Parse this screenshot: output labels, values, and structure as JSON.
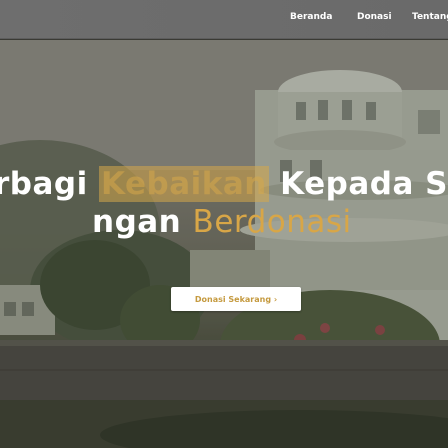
{
  "nav": {
    "items": [
      "Beranda",
      "Donasi",
      "Tentang"
    ]
  },
  "hero": {
    "line1_word1": "rbagi",
    "line1_word2": "Kebaikan",
    "line1_word3": "Kepada Sesa",
    "line2_word1": "ngan",
    "line2_word2": "Berdonasi",
    "cta_label": "Donasi Sekarang ›"
  },
  "colors": {
    "accent_gold": "#d8a647",
    "navbar_bg": "#6e6e6e",
    "button_bg": "#ffffff"
  }
}
